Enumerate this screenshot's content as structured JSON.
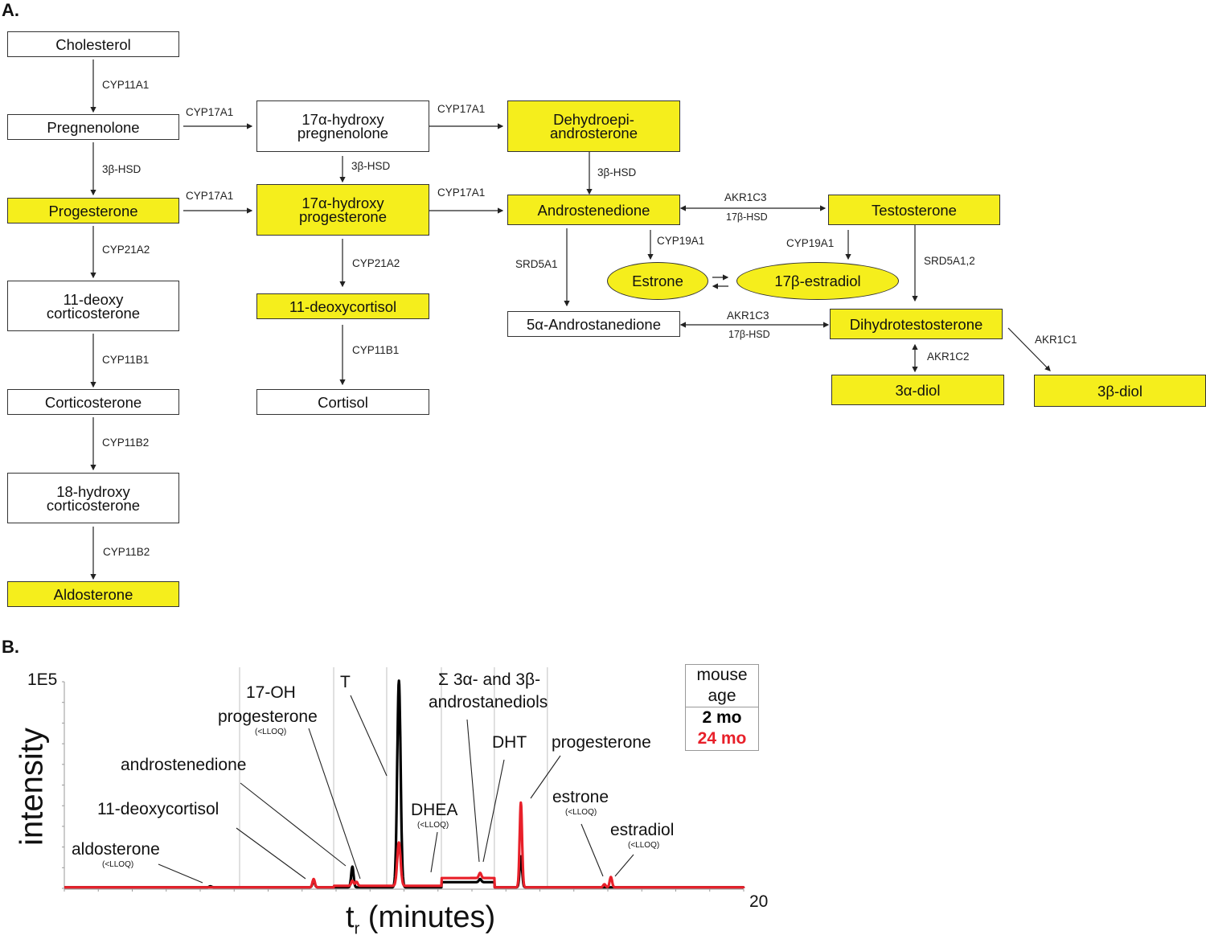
{
  "panel_a": {
    "label": "A.",
    "nodes": {
      "cholesterol": "Cholesterol",
      "pregnenolone": "Pregnenolone",
      "progesterone": "Progesterone",
      "deoxycorticosterone": [
        "11-deoxy",
        "corticosterone"
      ],
      "corticosterone": "Corticosterone",
      "hydroxycorticosterone": [
        "18-hydroxy",
        "corticosterone"
      ],
      "aldosterone": "Aldosterone",
      "oh_pregnenolone": [
        "17α-hydroxy",
        "pregnenolone"
      ],
      "oh_progesterone": [
        "17α-hydroxy",
        "progesterone"
      ],
      "deoxycortisol": "11-deoxycortisol",
      "cortisol": "Cortisol",
      "dhea": [
        "Dehydroepi-",
        "androsterone"
      ],
      "androstenedione": "Androstenedione",
      "testosterone": "Testosterone",
      "estrone": "Estrone",
      "estradiol": "17β-estradiol",
      "androstanedione": "5α-Androstanedione",
      "dht": "Dihydrotestosterone",
      "diol_3a": "3α-diol",
      "diol_3b": "3β-diol"
    },
    "enzymes": {
      "chol_preg": "CYP11A1",
      "preg_prog": "3β-HSD",
      "prog_doc": "CYP21A2",
      "doc_cort": "CYP11B1",
      "cort_18oh": "CYP11B2",
      "18oh_aldo": "CYP11B2",
      "preg_ohpreg": "CYP17A1",
      "prog_ohprog": "CYP17A1",
      "ohpreg_ohprog": "3β-HSD",
      "ohprog_deoxycortisol": "CYP21A2",
      "deoxycortisol_cortisol": "CYP11B1",
      "ohpreg_dhea": "CYP17A1",
      "ohprog_andro": "CYP17A1",
      "dhea_andro": "3β-HSD",
      "andro_testo_top": "AKR1C3",
      "andro_testo_bottom": "17β-HSD",
      "andro_estrone": "CYP19A1",
      "testo_estradiol": "CYP19A1",
      "andro_androstanedione": "SRD5A1",
      "testo_dht": "SRD5A1,2",
      "androstanedione_dht_top": "AKR1C3",
      "androstanedione_dht_bottom": "17β-HSD",
      "dht_3a": "AKR1C2",
      "dht_3b": "AKR1C1"
    },
    "highlight_color": "#f5ee1c"
  },
  "panel_b": {
    "label": "B.",
    "legend": {
      "title_line1": "mouse",
      "title_line2": "age",
      "series": [
        {
          "name": "2 mo",
          "color": "#000000"
        },
        {
          "name": "24 mo",
          "color": "#e8202a"
        }
      ]
    },
    "annotations": {
      "aldosterone": "aldosterone",
      "deoxycortisol": "11-deoxycortisol",
      "androstenedione": "androstenedione",
      "oh_prog_1": "17-OH",
      "oh_prog_2": "progesterone",
      "t": "T",
      "dhea": "DHEA",
      "diols_1": "Σ 3α- and 3β-",
      "diols_2": "androstanediols",
      "dht": "DHT",
      "progesterone": "progesterone",
      "estrone": "estrone",
      "estradiol": "estradiol",
      "lloq": "(<LLOQ)"
    }
  },
  "chart_data": {
    "type": "line",
    "title": "",
    "xlabel": "t_r (minutes)",
    "xlabel_main": "t",
    "xlabel_sub": "r",
    "xlabel_rest": " (minutes)",
    "ylabel": "intensity",
    "ytick_label": "1E5",
    "xtick_label": "20",
    "xlim": [
      0,
      20
    ],
    "ylim": [
      0,
      100000
    ],
    "segment_boundaries_min": [
      5.16,
      7.93,
      9.49,
      11.1,
      12.66,
      14.22
    ],
    "peaks": [
      {
        "analyte": "aldosterone",
        "t": 4.3,
        "2 mo": 500,
        "24 mo": 0,
        "lloq": true
      },
      {
        "analyte": "11-deoxycortisol",
        "t": 7.34,
        "2 mo": 3000,
        "24 mo": 4000
      },
      {
        "analyte": "androstenedione",
        "t": 8.48,
        "2 mo": 10000,
        "24 mo": 2500
      },
      {
        "analyte": "17-OH progesterone",
        "t": 8.6,
        "2 mo": 0,
        "24 mo": 2000,
        "lloq": true
      },
      {
        "analyte": "T",
        "t": 9.85,
        "2 mo": 100000,
        "24 mo": 21000
      },
      {
        "analyte": "DHEA",
        "t": 10.8,
        "2 mo": 0,
        "24 mo": 0,
        "lloq": true
      },
      {
        "analyte": "Σ 3α- and 3β-androstanediols",
        "t": 12.24,
        "2 mo": 1500,
        "24 mo": 2500
      },
      {
        "analyte": "progesterone",
        "t": 13.44,
        "2 mo": 15000,
        "24 mo": 41000
      },
      {
        "analyte": "estrone",
        "t": 15.9,
        "2 mo": 0,
        "24 mo": 1500,
        "lloq": true
      },
      {
        "analyte": "estradiol",
        "t": 16.09,
        "2 mo": 0,
        "24 mo": 5000,
        "lloq": true
      }
    ],
    "baselines": {
      "2 mo": [
        {
          "range": [
            0,
            12.66
          ],
          "level": 500
        },
        {
          "range": [
            11.1,
            12.66
          ],
          "level": 3000
        },
        {
          "range": [
            12.66,
            20
          ],
          "level": 500
        }
      ],
      "24 mo": [
        {
          "range": [
            0,
            7.93
          ],
          "level": 500
        },
        {
          "range": [
            7.93,
            11.1
          ],
          "level": 1200
        },
        {
          "range": [
            11.1,
            12.66
          ],
          "level": 5000
        },
        {
          "range": [
            12.66,
            20
          ],
          "level": 500
        }
      ]
    },
    "series": [
      {
        "name": "2 mo",
        "color": "#000000"
      },
      {
        "name": "24 mo",
        "color": "#e8202a"
      }
    ],
    "legend_position": "top-right",
    "grid": "vertical segment dividers"
  }
}
